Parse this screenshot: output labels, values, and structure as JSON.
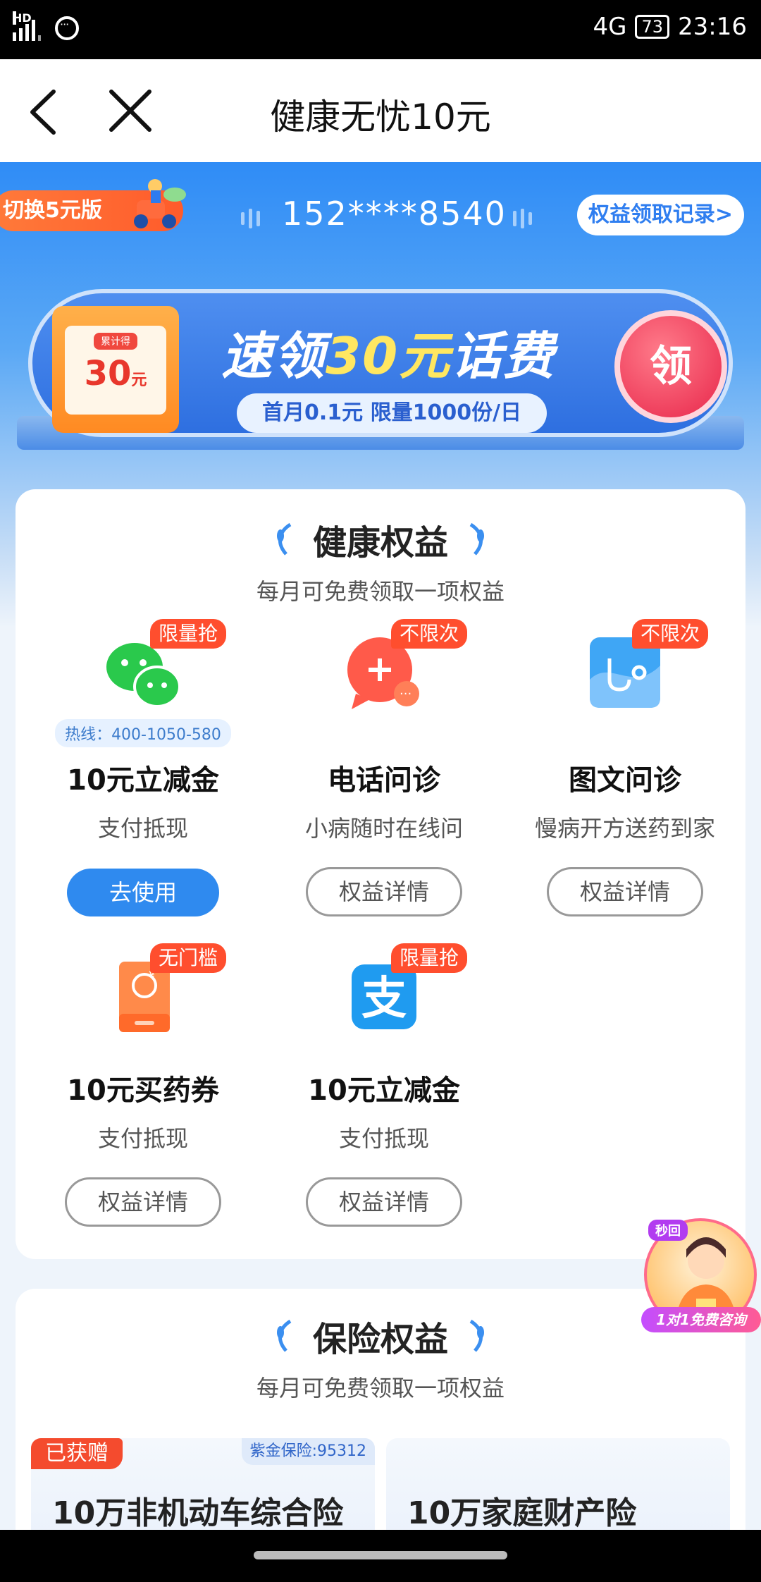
{
  "status_bar": {
    "hd": "HD",
    "network": "4G",
    "battery": "73",
    "time": "23:16"
  },
  "nav": {
    "title": "健康无忧10元"
  },
  "header": {
    "switch_label": "切换5元版",
    "phone": "152****8540",
    "record_label": "权益领取记录>"
  },
  "promo": {
    "gift_tag": "累计得",
    "gift_value": "30",
    "gift_unit": "元",
    "title_a": "速领",
    "title_b": "30元",
    "title_c": "话费",
    "subtitle": "首月0.1元 限量1000份/日",
    "button": "领"
  },
  "health": {
    "title": "健康权益",
    "subtitle": "每月可免费领取一项权益",
    "items": [
      {
        "badge": "限量抢",
        "hotline": "热线：400-1050-580",
        "title": "10元立减金",
        "sub": "支付抵现",
        "button": "去使用"
      },
      {
        "badge": "不限次",
        "title": "电话问诊",
        "sub": "小病随时在线问",
        "button": "权益详情"
      },
      {
        "badge": "不限次",
        "title": "图文问诊",
        "sub": "慢病开方送药到家",
        "button": "权益详情"
      },
      {
        "badge": "无门槛",
        "title": "10元买药券",
        "sub": "支付抵现",
        "button": "权益详情"
      },
      {
        "badge": "限量抢",
        "title": "10元立减金",
        "sub": "支付抵现",
        "button": "权益详情"
      }
    ]
  },
  "insurance": {
    "title": "保险权益",
    "subtitle": "每月可免费领取一项权益",
    "cards": [
      {
        "badge": "已获赠",
        "corp": "紫金保险:95312",
        "title": "10万非机动车综合险"
      },
      {
        "title": "10万家庭财产险"
      }
    ]
  },
  "float_consult": {
    "tag": "秒回",
    "label": "1对1免费咨询"
  },
  "colors": {
    "accent": "#2f8aef",
    "badge": "#ff4e2e",
    "wechat_green": "#2ac94c",
    "alipay_blue": "#1f9bf0"
  }
}
